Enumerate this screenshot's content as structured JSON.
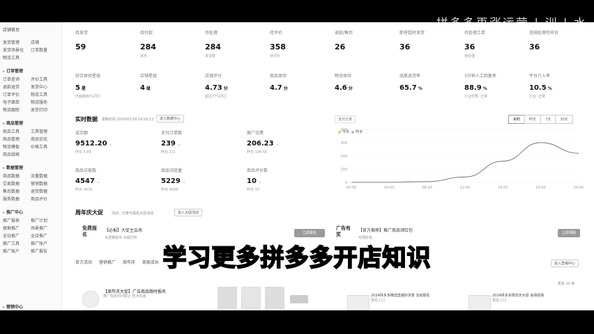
{
  "watermark": "拼多多再涨运营 | 训 | 水",
  "sidebar": {
    "top": "店铺首页",
    "groups": [
      {
        "title": "",
        "items": [
          [
            "发货管理",
            "店铺"
          ],
          [
            "发货场景化",
            "订单数量"
          ],
          [
            "物流工具",
            ""
          ]
        ]
      },
      {
        "title": "订单管理",
        "items": [
          [
            "订单查询",
            "评价工具"
          ],
          [
            "退款退货",
            "发货中心"
          ],
          [
            "订单评价",
            "物流工具"
          ],
          [
            "电子面单",
            "物流服务"
          ],
          [
            "物流跟踪",
            "发货打印"
          ]
        ]
      },
      {
        "title": "商品管理",
        "items": [
          [
            "商品工具",
            "工具管理"
          ],
          [
            "商品管理",
            "商品优化"
          ],
          [
            "物流模板",
            "价格工具"
          ],
          [
            "商品规格",
            ""
          ]
        ]
      },
      {
        "title": "数据管理",
        "items": [
          [
            "商品数据",
            "流量数据"
          ],
          [
            "交易数据",
            "营销数据"
          ],
          [
            "售后数据",
            "退货数据"
          ],
          [
            "服务数据",
            "商品评价"
          ]
        ]
      },
      {
        "title": "推广中心",
        "items": [
          [
            "推广报表",
            "推广计划"
          ],
          [
            "搜索推广",
            "场景推广"
          ],
          [
            "全站推广",
            "全店推广"
          ],
          [
            "推广工具",
            "推广账户"
          ],
          [
            "推广账户",
            "推广报告"
          ]
        ]
      }
    ],
    "bottom": "营销中心"
  },
  "kpis_row1": [
    {
      "label": "待发货",
      "value": "59",
      "sub": ""
    },
    {
      "label": "待付款",
      "value": "284",
      "sub": "本月"
    },
    {
      "label": "待处理",
      "value": "284",
      "sub": "发货数"
    },
    {
      "label": "待评价",
      "value": "358",
      "sub": "待评价"
    },
    {
      "label": "退款/售后",
      "value": "26",
      "sub": ""
    },
    {
      "label": "即将超时发货",
      "value": "36",
      "sub": ""
    },
    {
      "label": "待处理工单",
      "value": "36",
      "sub": "待处理"
    },
    {
      "label": "违规处理待申诉",
      "value": "36",
      "sub": ""
    }
  ],
  "kpis_row2": [
    {
      "label": "综合体验星级",
      "value": "5",
      "unit": "星",
      "sub": "已超越80%同行"
    },
    {
      "label": "店铺星级",
      "value": "4",
      "unit": "级",
      "sub": ""
    },
    {
      "label": "店铺评分",
      "value": "4.73",
      "unit": "分",
      "sub": "超过77%同行"
    },
    {
      "label": "商品体验",
      "value": "4.7",
      "unit": "分",
      "sub": ""
    },
    {
      "label": "物流体验",
      "value": "4.6",
      "unit": "分",
      "sub": ""
    },
    {
      "label": "品质退货率",
      "value": "65.7",
      "unit": "%",
      "sub": ""
    },
    {
      "label": "3分钟人工回复率",
      "value": "88.9",
      "unit": "%",
      "sub": "行业优秀: 正常"
    },
    {
      "label": "平台介入率",
      "value": "10.5",
      "unit": "%",
      "sub": "行业: 正常"
    }
  ],
  "realtime": {
    "title": "实时数据",
    "update_note": "更新时间 2024/07/18 14:50:12",
    "cta": "进入数据中心",
    "stats": [
      {
        "label": "成交额",
        "value": "9512.20",
        "sub": "昨日 5.89"
      },
      {
        "label": "支付订单数",
        "value": "239",
        "sub": "昨日 211"
      },
      {
        "label": "推广花费",
        "value": "206.23",
        "sub": "昨日 198.56"
      },
      {
        "label": "商品访客数",
        "value": "4547",
        "sub": "昨日 3479"
      },
      {
        "label": "商品浏览量",
        "value": "5229",
        "sub": "昨日 4008"
      },
      {
        "label": "商品评价数",
        "value": "10",
        "sub": "昨日 15"
      }
    ],
    "trend_glyph": "⟀",
    "chart_title": "支付订单",
    "ranges": [
      "实时",
      "昨天",
      "7天",
      "30天"
    ],
    "active_range": "实时"
  },
  "chart_data": {
    "type": "line",
    "x": [
      "00:00",
      "04:00",
      "08:00",
      "12:00",
      "16:00",
      "20:00",
      "24:00"
    ],
    "series": [
      {
        "name": "今天",
        "values": [
          0,
          0,
          5,
          40,
          160,
          300,
          220
        ]
      }
    ],
    "legend": [
      "今天",
      "昨天"
    ],
    "ylim": [
      0,
      400
    ],
    "yticks": [
      "0",
      "100",
      "200",
      "300",
      "400"
    ]
  },
  "promo": {
    "title": "周年庆大促",
    "desc": "活动：已参与报名大促活动",
    "cta": "进入大促活动",
    "cards": [
      {
        "badge": "免费报名",
        "title": "【必报】大促主会场",
        "sub": "大促报名中  大促打折",
        "btn": "立即报名"
      },
      {
        "badge": "广告有奖",
        "title": "【官方推荐】推广商品领红包",
        "sub": "可领红包",
        "btn": "立即领取"
      }
    ]
  },
  "tabs": [
    "官方活动",
    "营销推广",
    "周年庆",
    "商家成长"
  ],
  "tabs_right": "进入营销中心",
  "news_note": "更多 10 条",
  "news": [
    {
      "title": "【周年庆大促】广告商品限时报名",
      "meta": "推广报名时间截止 技术加速"
    },
    {
      "title": "2024拼多多精选直播好货季 活动报名",
      "meta": "报名入口"
    },
    {
      "title": "2024拼多多周年庆大促 会场招商",
      "meta": "报名入口"
    }
  ],
  "caption": "学习更多拼多多开店知识"
}
